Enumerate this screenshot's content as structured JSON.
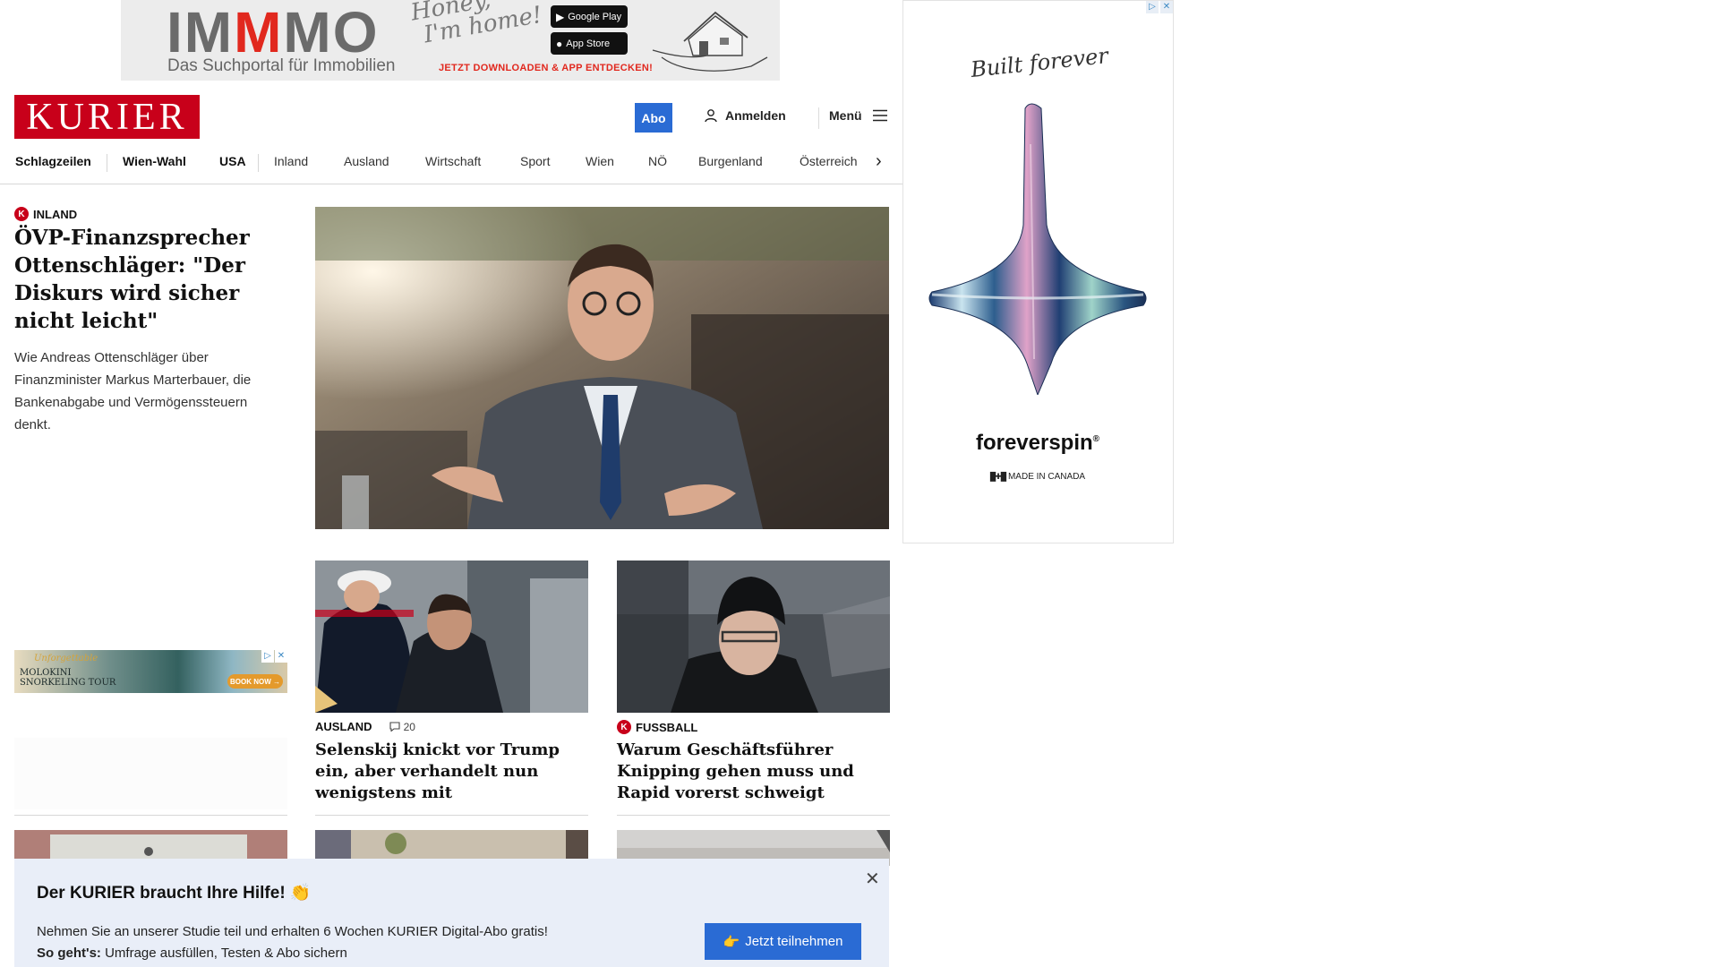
{
  "top_ad": {
    "brand_gray1": "IM",
    "brand_red": "M",
    "brand_gray2": "MO",
    "tagline": "Das Suchportal für Immobilien",
    "handwriting_line1": "Honey,",
    "handwriting_line2": "I'm home!",
    "google_play_label": "Google Play",
    "app_store_label": "App Store",
    "cta": "JETZT DOWNLOADEN & APP ENTDECKEN!"
  },
  "header": {
    "logo": "KURIER",
    "abo_label": "Abo",
    "login_label": "Anmelden",
    "menu_label": "Menü"
  },
  "nav": {
    "items": [
      "Schlagzeilen",
      "Wien-Wahl",
      "USA",
      "Inland",
      "Ausland",
      "Wirtschaft",
      "Sport",
      "Wien",
      "NÖ",
      "Burgenland",
      "Österreich"
    ]
  },
  "lead": {
    "kicker": "INLAND",
    "title": "ÖVP-Finanzsprecher Ottenschläger: \"Der Diskurs wird sicher nicht leicht\"",
    "teaser": "Wie Andreas Ottenschläger über Finanzminister Markus Marterbauer, die Bankenabgabe und Vermögenssteuern denkt."
  },
  "small_ad": {
    "line1": "Unforgettable",
    "line2": "MOLOKINI",
    "line3": "SNORKELING TOUR",
    "button": "BOOK NOW →"
  },
  "cards": [
    {
      "kicker": "AUSLAND",
      "comments": "20",
      "title": "Selenskij knickt vor Trump ein, aber verhandelt nun wenigstens mit"
    },
    {
      "kicker": "FUSSBALL",
      "title": "Warum Geschäftsführer Knipping gehen muss und Rapid vorerst schweigt"
    }
  ],
  "right_ad": {
    "script": "Built forever",
    "brand": "foreverspin",
    "made_in": "MADE IN CANADA"
  },
  "survey": {
    "title": "Der KURIER braucht Ihre Hilfe! 👏",
    "line1": "Nehmen Sie an unserer Studie teil und erhalten 6 Wochen KURIER Digital-Abo gratis!",
    "line2_bold": "So geht's:",
    "line2_rest": " Umfrage ausfüllen, Testen & Abo sichern",
    "button": "Jetzt teilnehmen",
    "button_emoji": "👉",
    "close": "✕"
  },
  "colors": {
    "brand_red": "#c8001a",
    "accent_blue": "#2a6bd4",
    "overlay_bg": "#e9eef8"
  }
}
